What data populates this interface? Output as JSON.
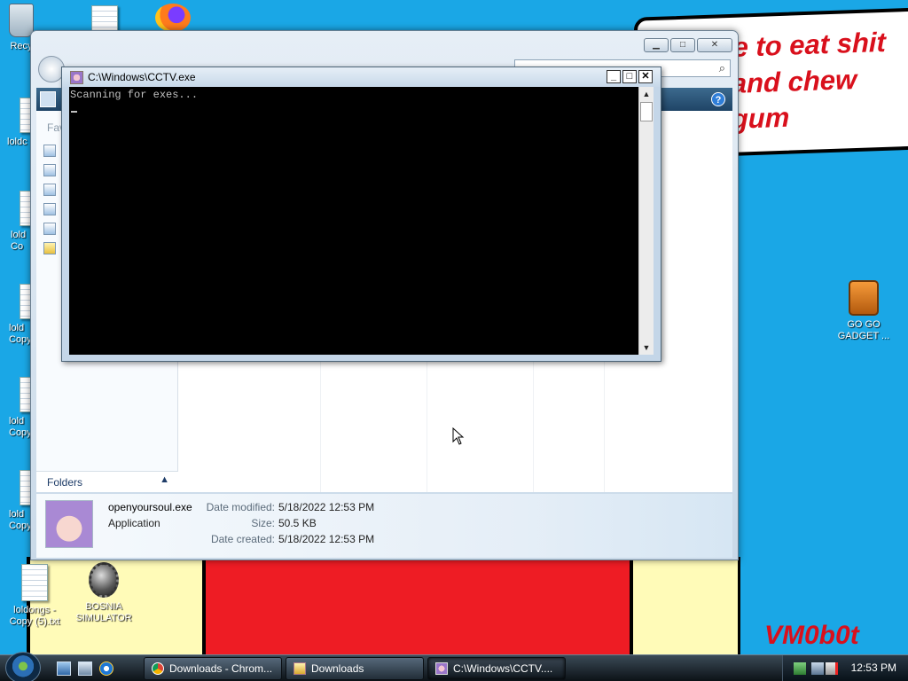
{
  "wallpaper": {
    "bubble_lines": [
      "me to eat shit",
      "e and chew",
      "e gum"
    ],
    "signature": "VM0b0t"
  },
  "desktop_icons": [
    {
      "label": "Recycle Bin",
      "short": "Recy",
      "icon": "recycle-bin-icon"
    },
    {
      "label": "loldongs - Copy (5).txt",
      "icon": "text-file-icon"
    },
    {
      "label": "BOSNIA SIMULATOR",
      "icon": "mine-shortcut-icon"
    },
    {
      "label": "GO GO GADGET ...",
      "icon": "briefcase-icon"
    }
  ],
  "desktop_partials": [
    "loldc",
    "lold\nCo",
    "lold\nCopy",
    "lold\nCopy",
    "lold\nCopy"
  ],
  "explorer": {
    "sidebar": {
      "favorites_label": "Fav",
      "folders_label": "Folders"
    },
    "details": {
      "file_name": "openyoursoul.exe",
      "file_type": "Application",
      "rows": [
        {
          "key": "Date modified:",
          "value": "5/18/2022 12:53 PM"
        },
        {
          "key": "Size:",
          "value": "50.5 KB"
        },
        {
          "key": "Date created:",
          "value": "5/18/2022 12:53 PM"
        }
      ]
    }
  },
  "console": {
    "title": "C:\\Windows\\CCTV.exe",
    "output": "Scanning for exes..."
  },
  "taskbar": {
    "buttons": [
      {
        "label": "Downloads - Chrom...",
        "icon": "chrome-icon"
      },
      {
        "label": "Downloads",
        "icon": "folder-icon"
      },
      {
        "label": "C:\\Windows\\CCTV....",
        "icon": "console-icon"
      }
    ],
    "clock": "12:53 PM"
  },
  "colors": {
    "desktop": "#1aa7e6",
    "bubble_text": "#d9101c",
    "console_bg": "#000000",
    "console_text": "#c0c0c0"
  }
}
